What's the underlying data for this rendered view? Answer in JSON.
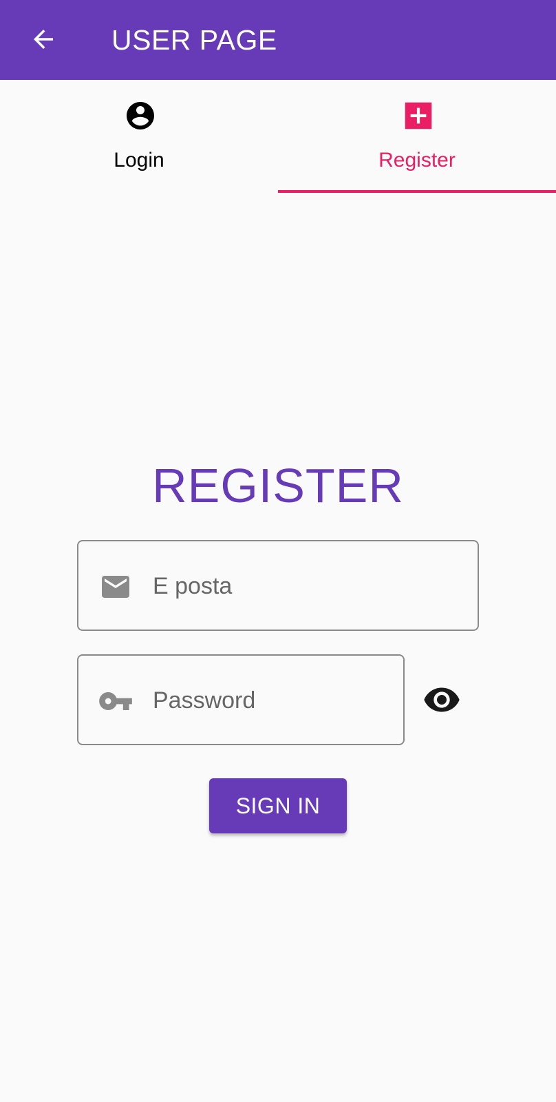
{
  "appbar": {
    "title": "USER PAGE",
    "back_icon": "arrow-back-icon",
    "color": "#673ab7"
  },
  "tabs": [
    {
      "label": "Login",
      "icon": "account-circle-icon",
      "selected": false
    },
    {
      "label": "Register",
      "icon": "add-box-icon",
      "selected": true
    }
  ],
  "accent_color": "#e91e63",
  "form": {
    "heading": "REGISTER",
    "email": {
      "placeholder": "E posta",
      "value": "",
      "icon": "mail-icon"
    },
    "password": {
      "placeholder": "Password",
      "value": "",
      "icon": "key-icon"
    },
    "visibility_icon": "eye-icon",
    "submit_label": "SIGN IN"
  }
}
